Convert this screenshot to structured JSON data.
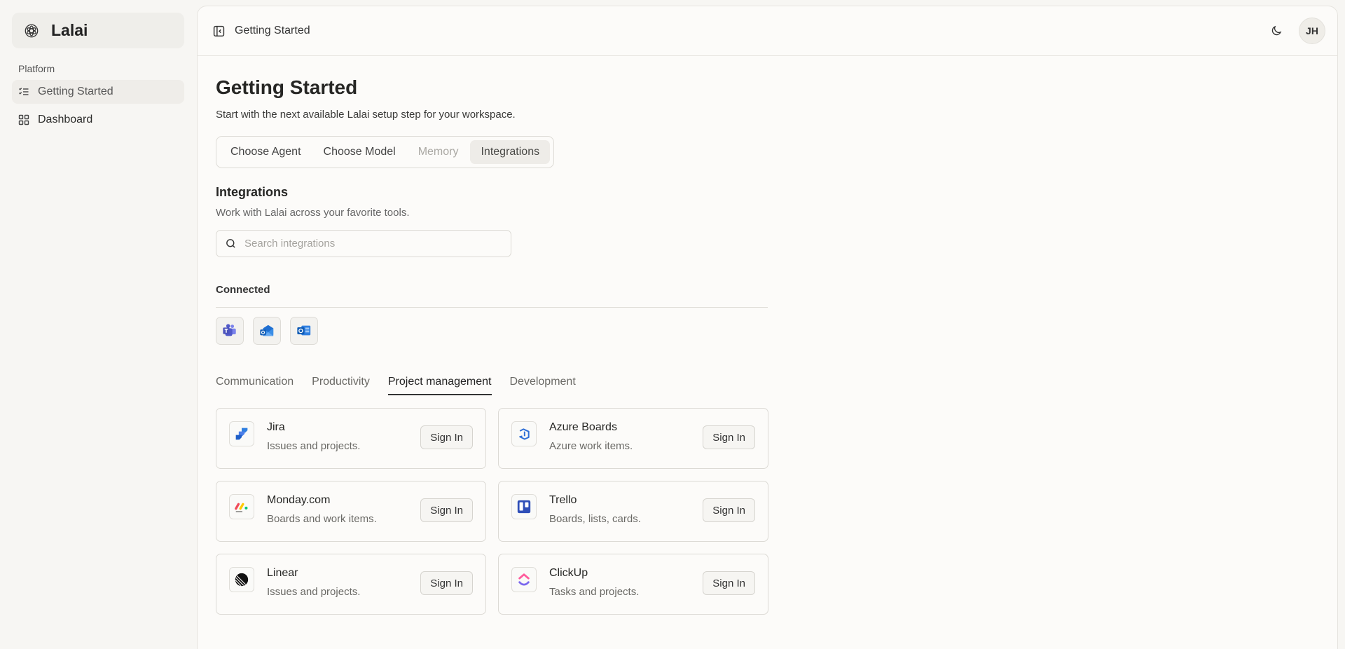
{
  "sidebar": {
    "brand": "Lalai",
    "section_label": "Platform",
    "items": [
      {
        "label": "Getting Started",
        "icon": "list-checks-icon",
        "active": true
      },
      {
        "label": "Dashboard",
        "icon": "grid-icon",
        "active": false
      }
    ]
  },
  "header": {
    "title": "Getting Started",
    "avatar_initials": "JH"
  },
  "page": {
    "title": "Getting Started",
    "subtitle": "Start with the next available Lalai setup step for your workspace."
  },
  "steps": [
    {
      "label": "Choose Agent",
      "state": "normal"
    },
    {
      "label": "Choose Model",
      "state": "normal"
    },
    {
      "label": "Memory",
      "state": "disabled"
    },
    {
      "label": "Integrations",
      "state": "active"
    }
  ],
  "integrations": {
    "title": "Integrations",
    "subtitle": "Work with Lalai across your favorite tools.",
    "search_placeholder": "Search integrations",
    "connected_label": "Connected",
    "connected": [
      "microsoft-teams-icon",
      "outlook-mail-icon",
      "outlook-icon"
    ],
    "categories": [
      {
        "label": "Communication",
        "active": false
      },
      {
        "label": "Productivity",
        "active": false
      },
      {
        "label": "Project management",
        "active": true
      },
      {
        "label": "Development",
        "active": false
      }
    ],
    "sign_in_label": "Sign In",
    "cards": [
      {
        "name": "Jira",
        "desc": "Issues and projects.",
        "icon": "jira-icon"
      },
      {
        "name": "Azure Boards",
        "desc": "Azure work items.",
        "icon": "azure-boards-icon"
      },
      {
        "name": "Monday.com",
        "desc": "Boards and work items.",
        "icon": "monday-icon"
      },
      {
        "name": "Trello",
        "desc": "Boards, lists, cards.",
        "icon": "trello-icon"
      },
      {
        "name": "Linear",
        "desc": "Issues and projects.",
        "icon": "linear-icon"
      },
      {
        "name": "ClickUp",
        "desc": "Tasks and projects.",
        "icon": "clickup-icon"
      }
    ]
  },
  "colors": {
    "background": "#f7f6f3",
    "panel": "#fcfbf9",
    "accent_teams": "#5059c9",
    "accent_trello": "#2f4fb8"
  }
}
